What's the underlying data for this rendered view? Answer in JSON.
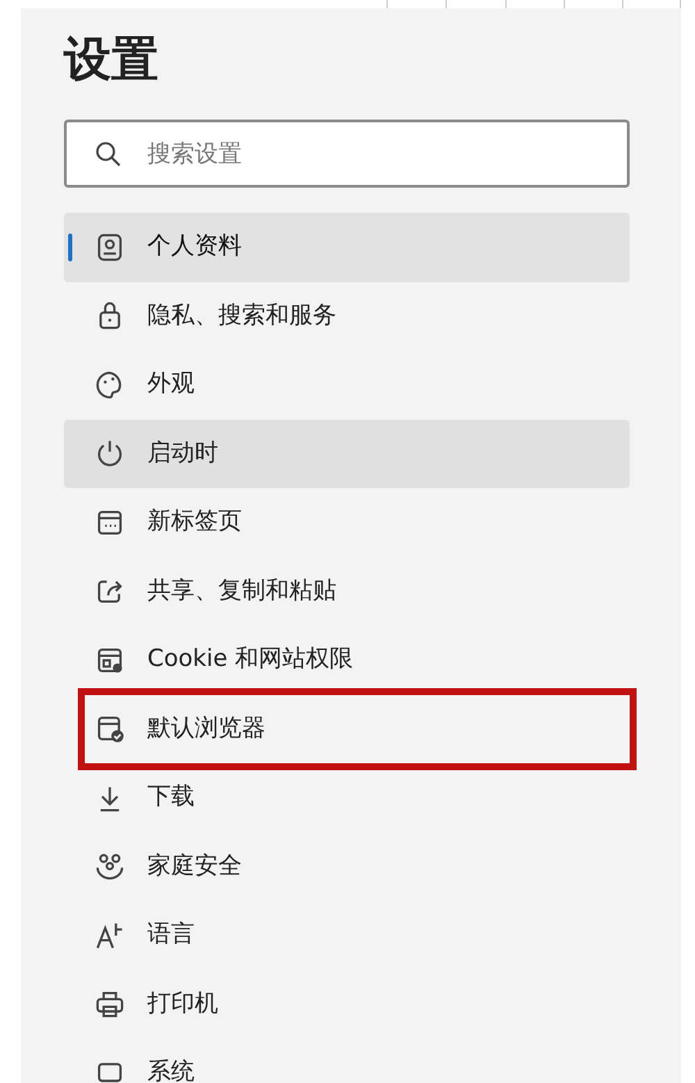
{
  "title": "设置",
  "search": {
    "placeholder": "搜索设置"
  },
  "menu": [
    {
      "label": "个人资料",
      "selected": true,
      "hovered": false,
      "annotated": false
    },
    {
      "label": "隐私、搜索和服务",
      "selected": false,
      "hovered": false,
      "annotated": false
    },
    {
      "label": "外观",
      "selected": false,
      "hovered": false,
      "annotated": false
    },
    {
      "label": "启动时",
      "selected": false,
      "hovered": true,
      "annotated": false
    },
    {
      "label": "新标签页",
      "selected": false,
      "hovered": false,
      "annotated": false
    },
    {
      "label": "共享、复制和粘贴",
      "selected": false,
      "hovered": false,
      "annotated": false
    },
    {
      "label": "Cookie 和网站权限",
      "selected": false,
      "hovered": false,
      "annotated": false
    },
    {
      "label": "默认浏览器",
      "selected": false,
      "hovered": false,
      "annotated": true
    },
    {
      "label": "下载",
      "selected": false,
      "hovered": false,
      "annotated": false
    },
    {
      "label": "家庭安全",
      "selected": false,
      "hovered": false,
      "annotated": false
    },
    {
      "label": "语言",
      "selected": false,
      "hovered": false,
      "annotated": false
    },
    {
      "label": "打印机",
      "selected": false,
      "hovered": false,
      "annotated": false
    },
    {
      "label": "系统",
      "selected": false,
      "hovered": false,
      "annotated": false
    }
  ]
}
